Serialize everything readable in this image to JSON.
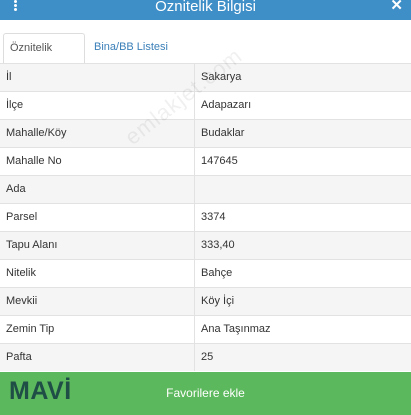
{
  "header": {
    "title": "Öznitelik Bilgisi",
    "menu_icon": "kebab-menu-icon",
    "close_icon": "close-icon"
  },
  "tabs": [
    {
      "label": "Öznitelik Bilgisi",
      "active": true
    },
    {
      "label": "Bina/BB Listesi",
      "active": false
    }
  ],
  "rows": [
    {
      "key": "İl",
      "value": "Sakarya"
    },
    {
      "key": "İlçe",
      "value": "Adapazarı"
    },
    {
      "key": "Mahalle/Köy",
      "value": "Budaklar"
    },
    {
      "key": "Mahalle No",
      "value": "147645"
    },
    {
      "key": "Ada",
      "value": ""
    },
    {
      "key": "Parsel",
      "value": "3374"
    },
    {
      "key": "Tapu Alanı",
      "value": "333,40"
    },
    {
      "key": "Nitelik",
      "value": "Bahçe"
    },
    {
      "key": "Mevkii",
      "value": "Köy İçi"
    },
    {
      "key": "Zemin Tip",
      "value": "Ana Taşınmaz"
    },
    {
      "key": "Pafta",
      "value": "25"
    }
  ],
  "watermark": "emlakjet.com",
  "logo": "MAVİ",
  "footer": {
    "button_label": "Favorilere ekle"
  },
  "colors": {
    "header": "#3e8ec7",
    "footer": "#5cb85c",
    "tab_link": "#3a7fb8"
  }
}
